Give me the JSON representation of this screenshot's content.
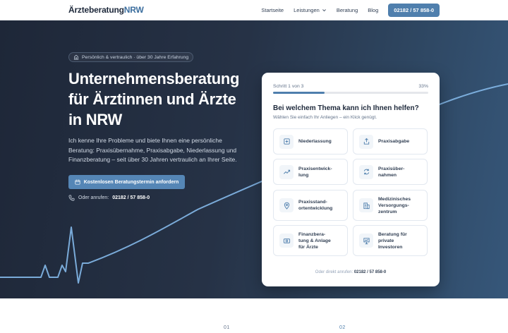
{
  "nav": {
    "logo_main": "Ärzteberatung",
    "logo_accent": "NRW",
    "links": [
      "Startseite",
      "Leistungen",
      "Beratung",
      "Blog"
    ],
    "phone_button": "02182 / 57 858-0"
  },
  "hero": {
    "badge": "Persönlich & vertraulich · über 30 Jahre Erfahrung",
    "title": "Unternehmensberatung für Ärztinnen und Ärzte in NRW",
    "lead": "Ich kenne Ihre Probleme und biete Ihnen eine persönliche Beratung: Praxisübernahme, Praxisabgabe, Niederlassung und Finanzberatung – seit über 30 Jahren vertraulich an Ihrer Seite.",
    "cta": "Kostenlosen Beratungstermin anfordern",
    "call_prefix": "Oder anrufen:",
    "call_number": "02182 / 57 858-0"
  },
  "wizard": {
    "step_text": "Schritt 1 von 3",
    "percent_text": "33%",
    "progress": 0.33,
    "question": "Bei welchem Thema kann ich Ihnen helfen?",
    "subtitle": "Wählen Sie einfach Ihr Anliegen – ein Klick genügt.",
    "options": [
      {
        "label": "Niederlassung",
        "icon": "clinic-icon"
      },
      {
        "label": "Praxisabgabe",
        "icon": "handover-icon"
      },
      {
        "label": "Praxisentwick-\nlung",
        "icon": "trend-up-icon"
      },
      {
        "label": "Praxisüber-\nnahmen",
        "icon": "refresh-icon"
      },
      {
        "label": "Praxisstand-\nortentwicklung",
        "icon": "location-pin-icon"
      },
      {
        "label": "Medizinisches\nVersorgungs-\nzentrum",
        "icon": "building-icon"
      },
      {
        "label": "Finanzbera-\ntung & Anlage\nfür Ärzte",
        "icon": "money-icon"
      },
      {
        "label": "Beratung für\nprivate\nInvestoren",
        "icon": "investor-icon"
      }
    ],
    "footer_prefix": "Oder direkt anrufen:",
    "footer_number": "02182 / 57 858-0"
  },
  "section": {
    "numbers": [
      "01",
      "02"
    ]
  },
  "colors": {
    "accent": "#4f7fad",
    "hero_dark": "#1e2738",
    "wave": "#7fb2e2"
  }
}
